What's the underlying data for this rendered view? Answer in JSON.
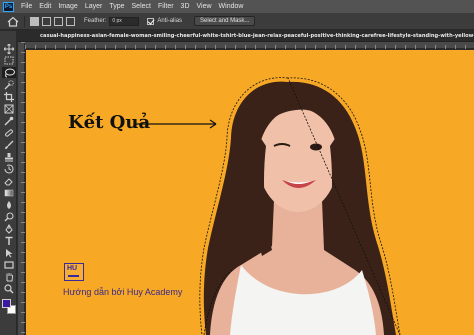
{
  "app": {
    "logo_text": "Ps"
  },
  "menu": [
    "File",
    "Edit",
    "Image",
    "Layer",
    "Type",
    "Select",
    "Filter",
    "3D",
    "View",
    "Window"
  ],
  "options": {
    "feather_label": "Feather:",
    "feather_value": "0 px",
    "antialias_label": "Anti-alias",
    "select_mask_label": "Select and Mask..."
  },
  "document": {
    "tab_title": "casual-happiness-asian-female-woman-smiling-cheerful-white-tshirt-blue-jean-relax-peaceful-positive-thinking-carefree-lifestyle-standing-with-yellow-color-background-"
  },
  "canvas": {
    "background_color": "#f7a825",
    "annotation_label": "Kết Quả",
    "brand_logo_text": "HU",
    "brand_text": "Hướng dẫn bởi Huy Academy"
  },
  "colors": {
    "foreground": "#3b1aa0",
    "background": "#ffffff",
    "accent": "#31a8ff"
  },
  "tools": [
    "move-tool",
    "marquee-tool",
    "lasso-tool",
    "quick-select-tool",
    "crop-tool",
    "frame-tool",
    "eyedropper-tool",
    "healing-brush-tool",
    "brush-tool",
    "clone-stamp-tool",
    "history-brush-tool",
    "eraser-tool",
    "gradient-tool",
    "blur-tool",
    "dodge-tool",
    "pen-tool",
    "type-tool",
    "path-select-tool",
    "rectangle-tool",
    "hand-tool",
    "zoom-tool"
  ]
}
